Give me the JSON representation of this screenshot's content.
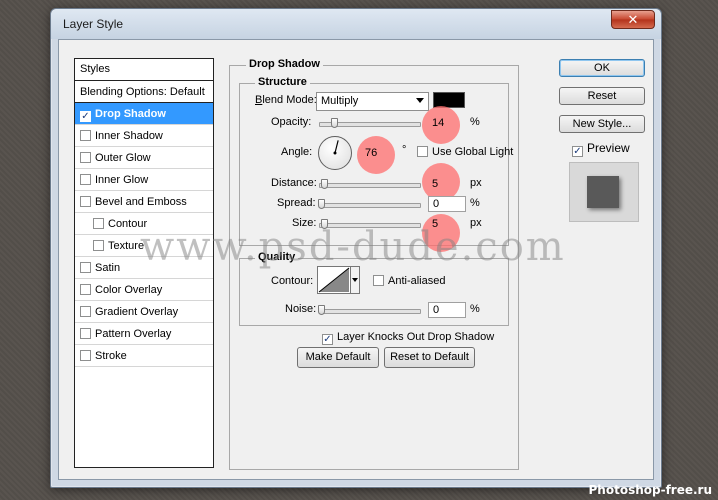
{
  "window": {
    "title": "Layer Style",
    "close_glyph": "✕"
  },
  "styles_list": {
    "header": "Styles",
    "blending": "Blending Options: Default",
    "items": [
      {
        "label": "Drop Shadow",
        "checked": true,
        "selected": true
      },
      {
        "label": "Inner Shadow",
        "checked": false
      },
      {
        "label": "Outer Glow",
        "checked": false
      },
      {
        "label": "Inner Glow",
        "checked": false
      },
      {
        "label": "Bevel and Emboss",
        "checked": false
      },
      {
        "label": "Contour",
        "checked": false,
        "sub": true
      },
      {
        "label": "Texture",
        "checked": false,
        "sub": true
      },
      {
        "label": "Satin",
        "checked": false
      },
      {
        "label": "Color Overlay",
        "checked": false
      },
      {
        "label": "Gradient Overlay",
        "checked": false
      },
      {
        "label": "Pattern Overlay",
        "checked": false
      },
      {
        "label": "Stroke",
        "checked": false
      }
    ]
  },
  "drop_shadow": {
    "section_title": "Drop Shadow",
    "structure_title": "Structure",
    "blend_mode_label_pre": "B",
    "blend_mode_label_rest": "lend Mode:",
    "blend_mode_value": "Multiply",
    "shadow_color": "#000000",
    "opacity_label": "Opacity:",
    "opacity_value": "14",
    "opacity_unit": "%",
    "opacity_fraction": 0.14,
    "angle_label": "Angle:",
    "angle_value": "76",
    "angle_unit": "°",
    "use_global_light_label": "Use Global Light",
    "use_global_light": false,
    "distance_label": "Distance:",
    "distance_value": "5",
    "distance_unit": "px",
    "spread_label": "Spread:",
    "spread_value": "0",
    "spread_unit": "%",
    "size_label": "Size:",
    "size_value": "5",
    "size_unit": "px",
    "quality_title": "Quality",
    "contour_label": "Contour:",
    "anti_aliased_label": "Anti-aliased",
    "anti_aliased": false,
    "noise_label": "Noise:",
    "noise_value": "0",
    "noise_unit": "%",
    "knocks_out_label": "Layer Knocks Out Drop Shadow",
    "knocks_out": true,
    "make_default_label": "Make Default",
    "reset_default_label": "Reset to Default"
  },
  "buttons": {
    "ok": "OK",
    "reset": "Reset",
    "new_style": "New Style...",
    "preview_label": "Preview",
    "preview_checked": true
  },
  "overlay": {
    "watermark": "www.psd-dude.com",
    "brand": "Photoshop-free.ru"
  },
  "colors": {
    "accent_selection": "#3399ff",
    "highlight_dot": "#ff6e6e"
  }
}
